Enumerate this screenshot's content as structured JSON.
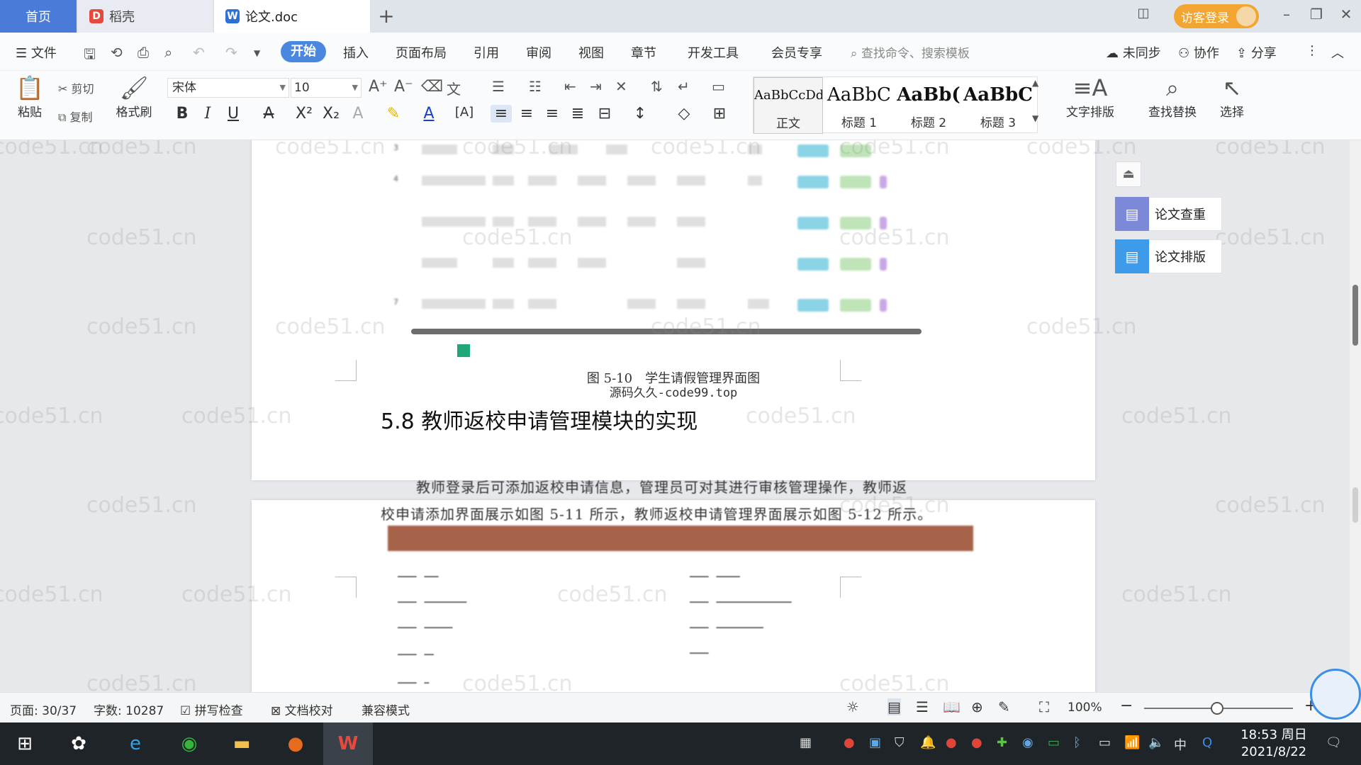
{
  "tabs": {
    "home": "首页",
    "daoke": "稻壳",
    "doc": "论文.doc"
  },
  "titlebar": {
    "visitor_login": "访客登录"
  },
  "menu": {
    "file": "文件",
    "items": [
      "开始",
      "插入",
      "页面布局",
      "引用",
      "审阅",
      "视图",
      "章节",
      "开发工具",
      "会员专享"
    ],
    "search_placeholder": "查找命令、搜索模板",
    "unsync": "未同步",
    "collab": "协作",
    "share": "分享"
  },
  "ribbon": {
    "paste": "粘贴",
    "cut": "剪切",
    "copy": "复制",
    "format_painter": "格式刷",
    "font_name": "宋体",
    "font_size": "10",
    "styles": [
      {
        "preview": "AaBbCcDd",
        "name": "正文"
      },
      {
        "preview": "AaBbC",
        "name": "标题 1"
      },
      {
        "preview": "AaBb(",
        "name": "标题 2"
      },
      {
        "preview": "AaBbC",
        "name": "标题 3"
      }
    ],
    "text_layout": "文字排版",
    "find_replace": "查找替换",
    "select": "选择"
  },
  "document": {
    "figure_caption": "图 5-10　学生请假管理界面图",
    "source_watermark": "源码久久-code99.top",
    "heading": "5.8 教师返校申请管理模块的实现",
    "para_line1": "教师登录后可添加返校申请信息，管理员可对其进行审核管理操作，教师返",
    "para_line2": "校申请添加界面展示如图 5-11 所示，教师返校申请管理界面展示如图 5-12 所示。",
    "table_row_nums": [
      "3",
      "4",
      "",
      "",
      "7"
    ]
  },
  "side_panel": {
    "check": "论文查重",
    "format": "论文排版"
  },
  "watermark_text": "code51.cn",
  "status": {
    "page": "页面: 30/37",
    "words": "字数: 10287",
    "spell": "拼写检查",
    "proof": "文档校对",
    "compat": "兼容模式",
    "zoom": "100%"
  },
  "taskbar": {
    "time": "18:53 周日",
    "date": "2021/8/22",
    "ime": "中"
  },
  "colors": {
    "tab_home": "#4b7bd8",
    "menu_active": "#4a88e0",
    "visitor": "#f2a531",
    "brown_bar": "#a7634a",
    "check_icon": "#7c88d8",
    "format_icon": "#3d9be9"
  }
}
